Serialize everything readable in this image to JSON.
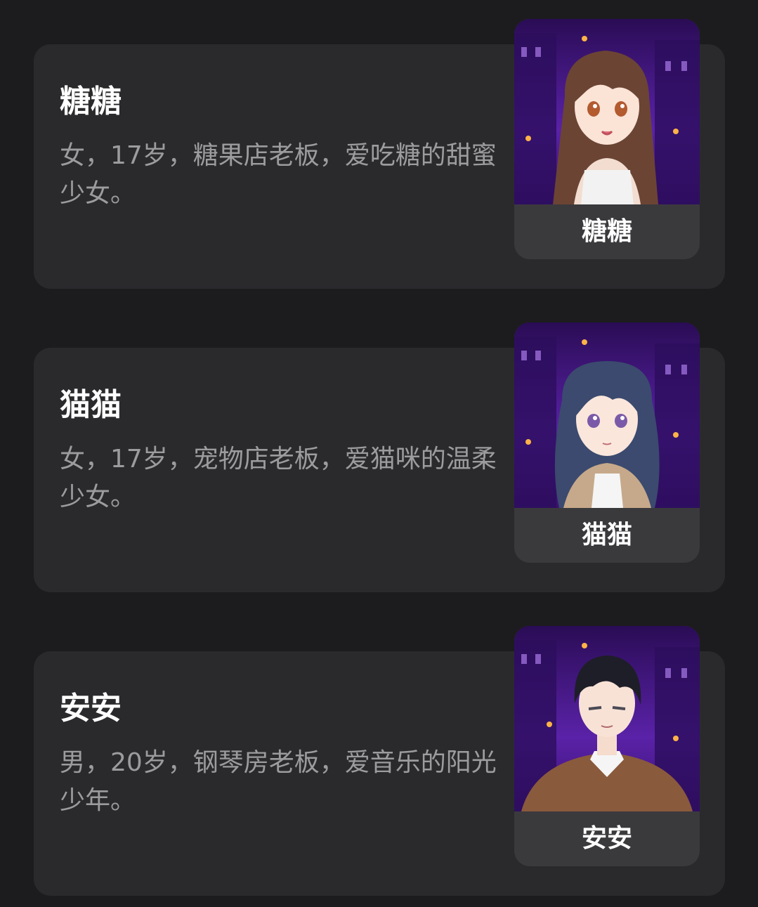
{
  "characters": [
    {
      "name": "糖糖",
      "description": "女，17岁，糖果店老板，爱吃糖的甜蜜少女。",
      "portrait_label": "糖糖",
      "hair_color": "#6b4434",
      "eye_color": "#b35a2f",
      "outfit_color": "#f2f2f2"
    },
    {
      "name": "猫猫",
      "description": "女，17岁，宠物店老板，爱猫咪的温柔少女。",
      "portrait_label": "猫猫",
      "hair_color": "#3b4a6e",
      "eye_color": "#7a5aa8",
      "outfit_color": "#c6a98a"
    },
    {
      "name": "安安",
      "description": "男，20岁，钢琴房老板，爱音乐的阳光少年。",
      "portrait_label": "安安",
      "hair_color": "#1e1e28",
      "eye_color": "#4a4a55",
      "outfit_color": "#8a5a3c"
    }
  ],
  "colors": {
    "background": "#1c1c1e",
    "card": "#2a2a2d",
    "portrait_label_bg": "#3a3a3d",
    "name_text": "#ffffff",
    "description_text": "#9c9c9f",
    "portrait_bg_purple": "#4b1a8c"
  }
}
